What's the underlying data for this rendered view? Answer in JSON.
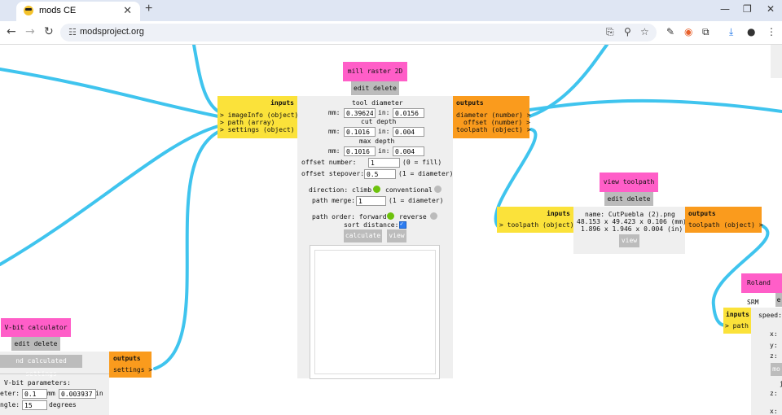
{
  "browser": {
    "tab_title": "mods CE",
    "tab_close": "✕",
    "new_tab": "+",
    "url": "modsproject.org",
    "win": {
      "min": "—",
      "max": "❐",
      "close": "✕"
    }
  },
  "nodes": {
    "mill": {
      "title": "mill raster 2D",
      "edit_delete": "edit delete",
      "inputs_label": "inputs",
      "inputs": [
        "> imageInfo (object)",
        "> path (array)",
        "> settings (object)"
      ],
      "outputs_label": "outputs",
      "outputs": [
        "diameter (number) >",
        "offset (number) >",
        "toolpath (object) >"
      ],
      "tool_diameter_label": "tool diameter",
      "tool_mm": "0.39624",
      "tool_in": "0.0156",
      "cut_depth_label": "cut depth",
      "cut_mm": "0.1016",
      "cut_in": "0.004",
      "max_depth_label": "max depth",
      "max_mm": "0.1016",
      "max_in": "0.004",
      "mm_label": "mm:",
      "in_label": "in:",
      "offset_number_label": "offset number:",
      "offset_number": "1",
      "offset_number_note": "(0 = fill)",
      "offset_stepover_label": "offset stepover:",
      "offset_stepover": "0.5",
      "offset_stepover_note": "(1 = diameter)",
      "direction_label": "direction: climb",
      "conventional_label": "conventional",
      "path_merge_label": "path merge:",
      "path_merge": "1",
      "path_merge_note": "(1 = diameter)",
      "path_order_label": "path order: forward",
      "reverse_label": "reverse",
      "sort_distance_label": "sort distance:",
      "calculate": "calculate",
      "view": "view"
    },
    "view_toolpath": {
      "title": "view toolpath",
      "edit_delete": "edit delete",
      "inputs_label": "inputs",
      "input": "> toolpath (object)",
      "outputs_label": "outputs",
      "output": "toolpath (object) >",
      "name_line": "name: CutPuebla (2).png",
      "mm_line": "48.153 x 49.423 x 0.106 (mm)",
      "in_line": "1.896 x 1.946 x 0.004 (in)",
      "view": "view"
    },
    "roland": {
      "title": "Roland SRM",
      "edit_partial": "e",
      "inputs_label": "inputs",
      "input": "> path",
      "speed_label": "speed:",
      "x_label": "x:",
      "y_label": "y:",
      "z_label": "z:",
      "move_partial": "mo",
      "j_partial": "j",
      "z2_label": "z:",
      "x2_label": "x:"
    },
    "vbit": {
      "title": "V-bit calculator",
      "edit_delete": "edit delete",
      "send_button": "nd calculated settings",
      "outputs_label": "outputs",
      "output": "settings >",
      "params_label": "V-bit parameters:",
      "diameter_label": "eter:",
      "diameter_mm": "0.1",
      "mm_label": "mm",
      "diameter_in": "0.003937",
      "in_label": "in",
      "angle_label": "ngle:",
      "angle": "15",
      "degrees_label": "degrees"
    }
  },
  "colors": {
    "wire": "#3fc4ee",
    "title": "#ff5ec8",
    "inputs": "#fbe23a",
    "outputs": "#fa9b1d",
    "toggle_on": "#6dc20d",
    "toggle_off": "#bbbbbb"
  }
}
